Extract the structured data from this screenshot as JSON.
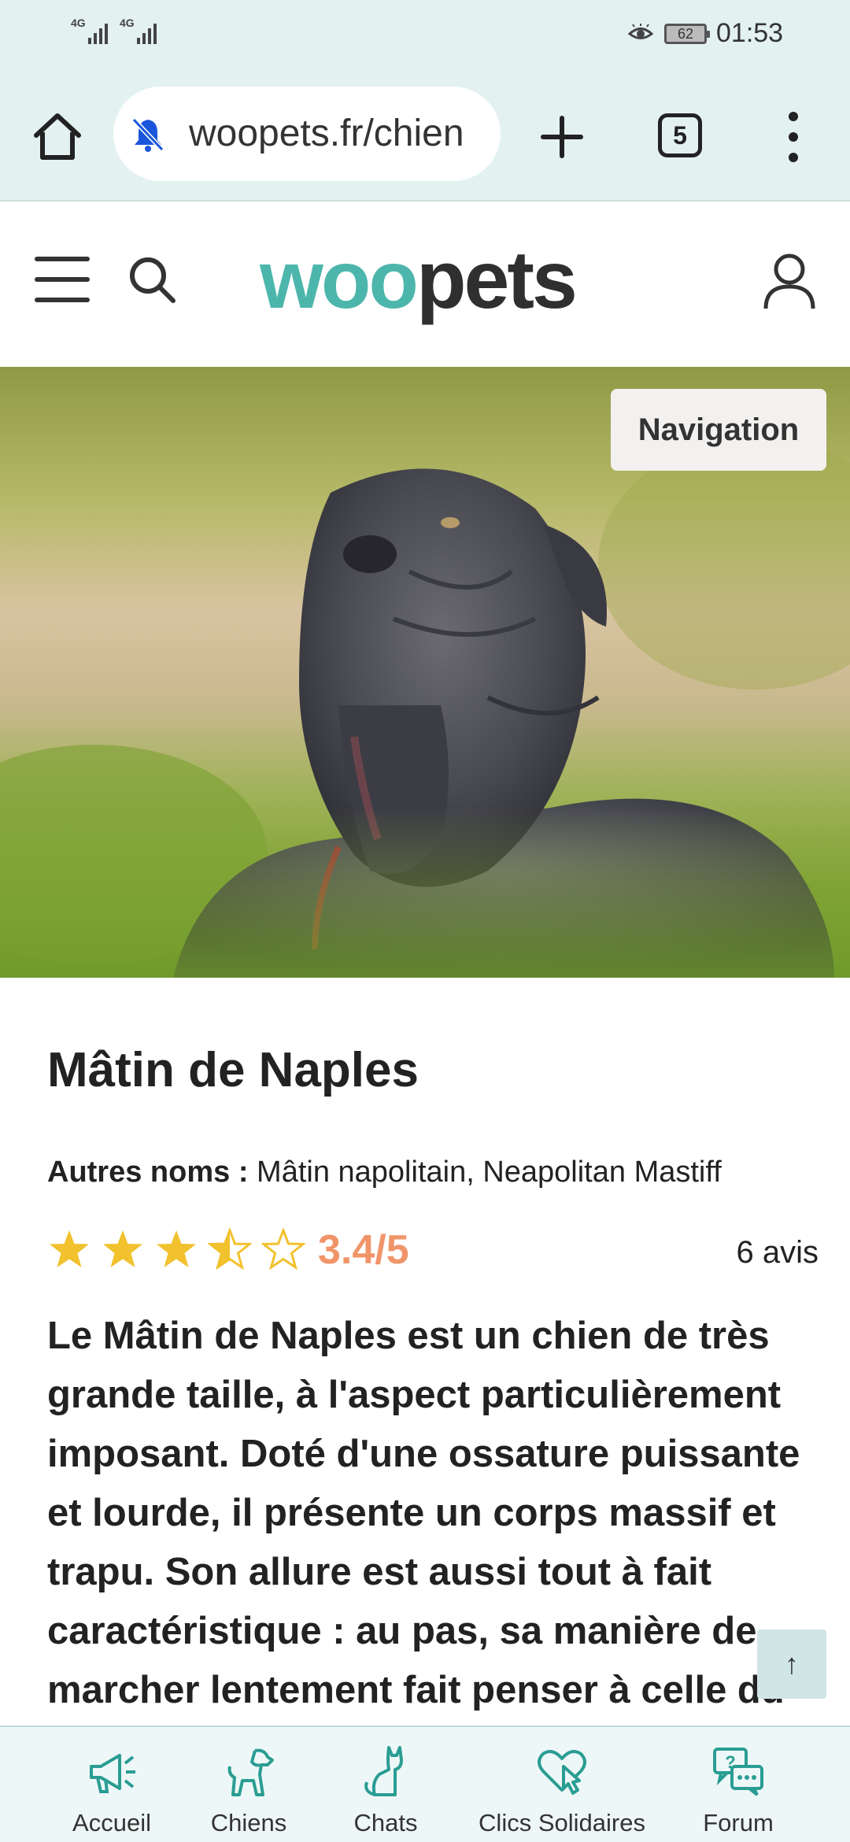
{
  "status_bar": {
    "network_1": "4G",
    "network_2": "4G",
    "battery": "62",
    "time": "01:53",
    "icons": [
      "signal-icon",
      "eye-comfort-icon",
      "battery-icon"
    ]
  },
  "browser": {
    "url": "woopets.fr/chien",
    "tab_count": "5",
    "icons": [
      "home-icon",
      "bell-off-icon",
      "plus-icon",
      "tabs-icon",
      "more-vert-icon"
    ]
  },
  "header": {
    "logo_part1": "woo",
    "logo_part2": "pets",
    "icons": [
      "menu-icon",
      "search-icon",
      "user-icon"
    ],
    "brand_color": "#4db6ac"
  },
  "hero": {
    "nav_button_label": "Navigation"
  },
  "article": {
    "title": "Mâtin de Naples",
    "other_names_label": "Autres noms :",
    "other_names_value": " Mâtin napolitain, Neapolitan Mastiff",
    "rating_score": "3.4/5",
    "rating_value": 3.4,
    "rating_max": 5,
    "review_count": "6 avis",
    "intro": "Le Mâtin de Naples est un chien de très grande taille, à l'aspect particulièrement imposant. Doté d'une ossature puissante et lourde, il présente un corps massif et trapu. Son allure est aussi tout à fait caractéristique : au pas, sa manière de marcher lentement fait penser à celle du"
  },
  "scroll_top_label": "↑",
  "bottom_nav": [
    {
      "label": "Accueil",
      "icon": "megaphone-icon"
    },
    {
      "label": "Chiens",
      "icon": "dog-icon"
    },
    {
      "label": "Chats",
      "icon": "cat-icon"
    },
    {
      "label": "Clics Solidaires",
      "icon": "heart-click-icon"
    },
    {
      "label": "Forum",
      "icon": "chat-bubbles-icon"
    }
  ],
  "colors": {
    "star": "#f2c12e",
    "score": "#f0956a",
    "accent": "#4db6ac"
  }
}
